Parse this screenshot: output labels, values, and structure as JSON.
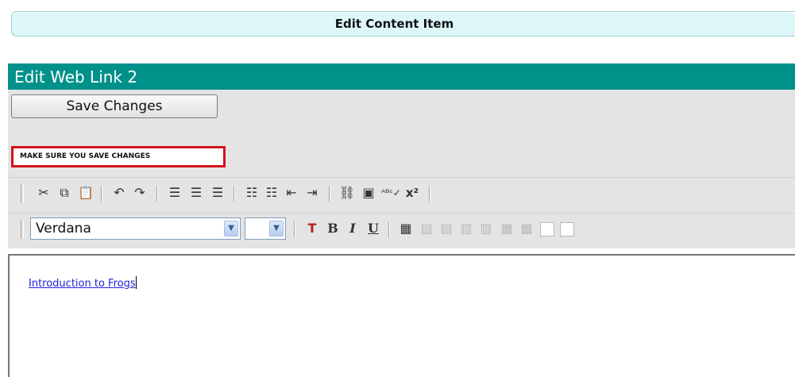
{
  "page": {
    "header_title": "Edit Content Item",
    "section_title": "Edit Web Link 2"
  },
  "actions": {
    "save_label": "Save Changes",
    "warning_text": "MAKE SURE YOU SAVE CHANGES"
  },
  "toolbar": {
    "row1_icons": [
      "cut-icon",
      "copy-icon",
      "paste-icon",
      "undo-icon",
      "redo-icon",
      "align-left-icon",
      "align-center-icon",
      "align-right-icon",
      "numbered-list-icon",
      "bulleted-list-icon",
      "outdent-icon",
      "indent-icon",
      "link-icon",
      "image-icon",
      "spellcheck-icon",
      "superscript-icon"
    ],
    "font_family_value": "Verdana",
    "font_size_value": "",
    "formatting": {
      "text_color_label": "T",
      "bold_label": "B",
      "italic_label": "I",
      "underline_label": "U"
    },
    "superscript_label": "x²",
    "row2_icons": [
      "text-color-icon",
      "bold-icon",
      "italic-icon",
      "underline-icon",
      "table-icon",
      "table-insert-row-icon",
      "table-delete-row-icon",
      "table-insert-col-icon",
      "table-delete-col-icon",
      "table-merge-icon",
      "table-split-icon",
      "cell-props-icon",
      "table-props-icon"
    ]
  },
  "editor": {
    "link_text": "Introduction to Frogs"
  },
  "colors": {
    "header_bg": "#ddf7f9",
    "section_bar": "#00918a",
    "warning_border": "#d2121b",
    "link": "#2323d9"
  }
}
